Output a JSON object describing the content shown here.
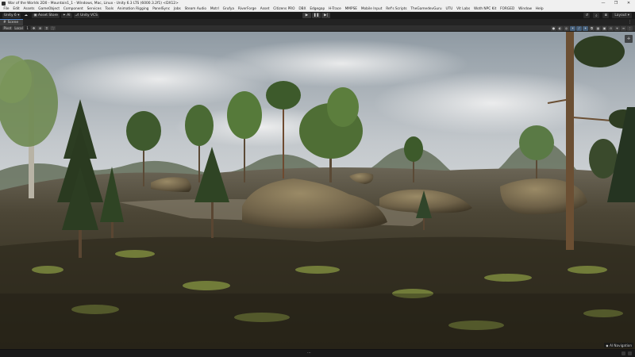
{
  "window": {
    "title": "War of the Worlds 2D0 - Mountain1_1 - Windows, Mac, Linux - Unity 6.3 LTS (6000.3.2f1) <DX12>",
    "controls": [
      "—",
      "❐",
      "✕"
    ]
  },
  "menu": [
    "File",
    "Edit",
    "Assets",
    "GameObject",
    "Component",
    "Services",
    "Tools",
    "Animation Rigging",
    "PanelSync",
    "Jobs",
    "Steam Audio",
    "Motrl",
    "Grufya",
    "RiverForge",
    "Asset",
    "Citizens PRO",
    "DBX",
    "Edgegap",
    "H-Trace",
    "MMPSE",
    "Mobile Input",
    "Ref's Scripts",
    "TheGamedevGuru",
    "UTU",
    "Vit Labs",
    "Woth NPC Kit",
    "FORGED",
    "Window",
    "Help"
  ],
  "toolbar": {
    "account": "Unity 6",
    "account_dropdown": "▾",
    "cloud_icon": "☁",
    "asset_store": "Asset Store",
    "ai": "AI",
    "vcs": "Unity VCS",
    "play": "▶",
    "pause": "❚❚",
    "step": "▶|",
    "layout": "Layout"
  },
  "tabs": [
    {
      "label": "Scene"
    }
  ],
  "scene_toolbar": {
    "pivot": "Pivot",
    "local": "Local",
    "grid_count": "1",
    "tool_icons": [
      "✥",
      "⊞",
      "⌗",
      "⛶"
    ],
    "view_icons": [
      "●",
      "◐",
      "◎",
      "☀",
      "♪",
      "✦",
      "⧉",
      "▦",
      "▣",
      "⊙",
      "⌖",
      "≡",
      "⋮"
    ]
  },
  "scene": {
    "overlay_label": "AI Navigation",
    "overlay_icon": "◆",
    "gizmo": "✛",
    "handle": "···"
  }
}
